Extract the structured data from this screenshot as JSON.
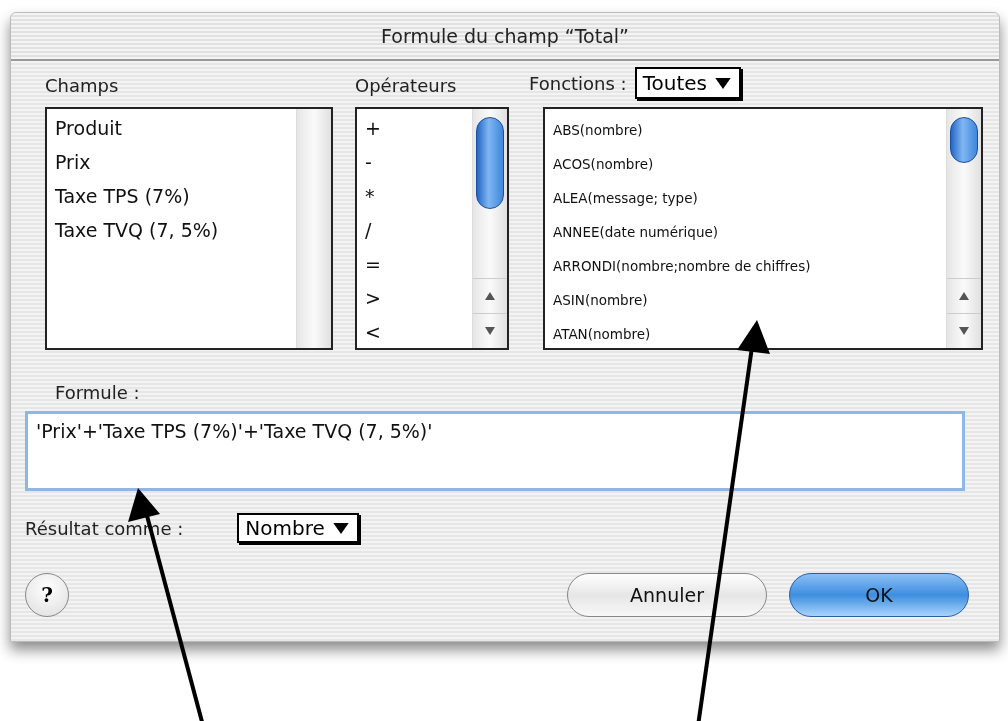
{
  "window": {
    "title": "Formule du champ “Total”"
  },
  "fields": {
    "label": "Champs",
    "items": [
      "Produit",
      "Prix",
      "Taxe TPS (7%)",
      "Taxe TVQ (7, 5%)"
    ]
  },
  "operators": {
    "label": "Opérateurs",
    "items": [
      "+",
      "-",
      "*",
      "/",
      "=",
      ">",
      "<"
    ]
  },
  "functions": {
    "label": "Fonctions :",
    "filter": "Toutes",
    "items": [
      "ABS(nombre)",
      "ACOS(nombre)",
      "ALEA(message; type)",
      "ANNEE(date numérique)",
      "ARRONDI(nombre;nombre de chiffres)",
      "ASIN(nombre)",
      "ATAN(nombre)"
    ]
  },
  "formula": {
    "label": "Formule :",
    "value": "'Prix'+'Taxe TPS (7%)'+'Taxe TVQ (7, 5%)'"
  },
  "result": {
    "label": "Résultat comme :",
    "type": "Nombre"
  },
  "buttons": [
    {
      "label": "?",
      "kind": "help"
    },
    {
      "label": "Annuler",
      "kind": "cancel"
    },
    {
      "label": "OK",
      "kind": "default"
    }
  ]
}
